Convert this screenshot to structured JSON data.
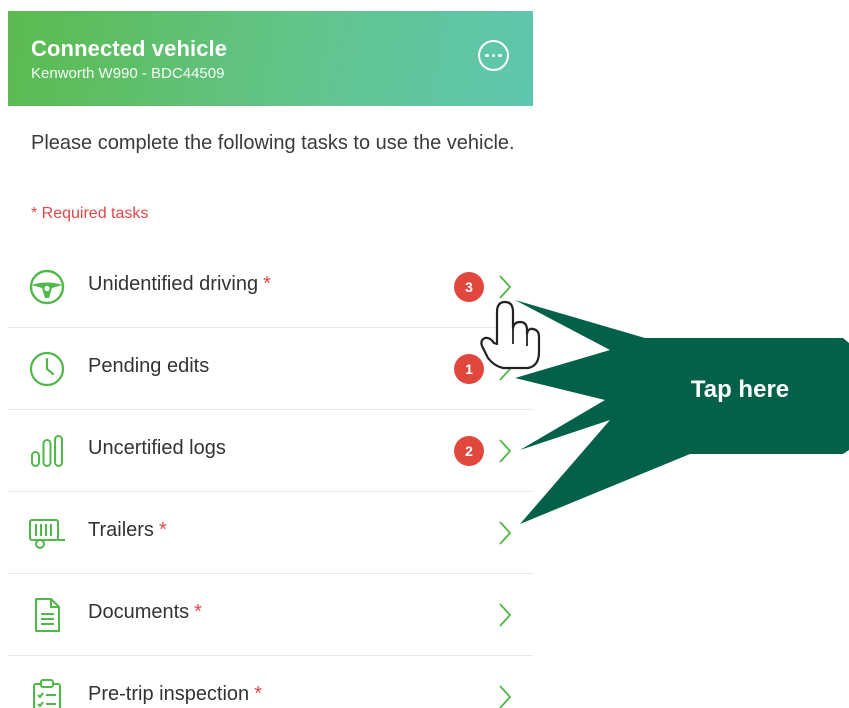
{
  "header": {
    "title": "Connected vehicle",
    "subtitle": "Kenworth W990 - BDC44509"
  },
  "intro_text": "Please complete the following tasks to use the vehicle.",
  "required_note": "* Required tasks",
  "tasks": [
    {
      "label": "Unidentified driving",
      "required": "*",
      "badge": "3",
      "icon": "steering-wheel-icon"
    },
    {
      "label": "Pending edits",
      "required": "",
      "badge": "1",
      "icon": "clock-icon"
    },
    {
      "label": "Uncertified logs",
      "required": "",
      "badge": "2",
      "icon": "bar-chart-icon"
    },
    {
      "label": "Trailers",
      "required": "*",
      "badge": "",
      "icon": "trailer-icon"
    },
    {
      "label": "Documents",
      "required": "*",
      "badge": "",
      "icon": "document-icon"
    },
    {
      "label": "Pre-trip inspection",
      "required": "*",
      "badge": "",
      "icon": "clipboard-checklist-icon"
    }
  ],
  "callout": {
    "text": "Tap here"
  },
  "colors": {
    "accent_green": "#4fb848",
    "header_gradient_start": "#5bbb4f",
    "header_gradient_end": "#5fc6b0",
    "badge_red": "#e0483e",
    "required_red": "#e04848",
    "callout_green": "#03614a"
  }
}
